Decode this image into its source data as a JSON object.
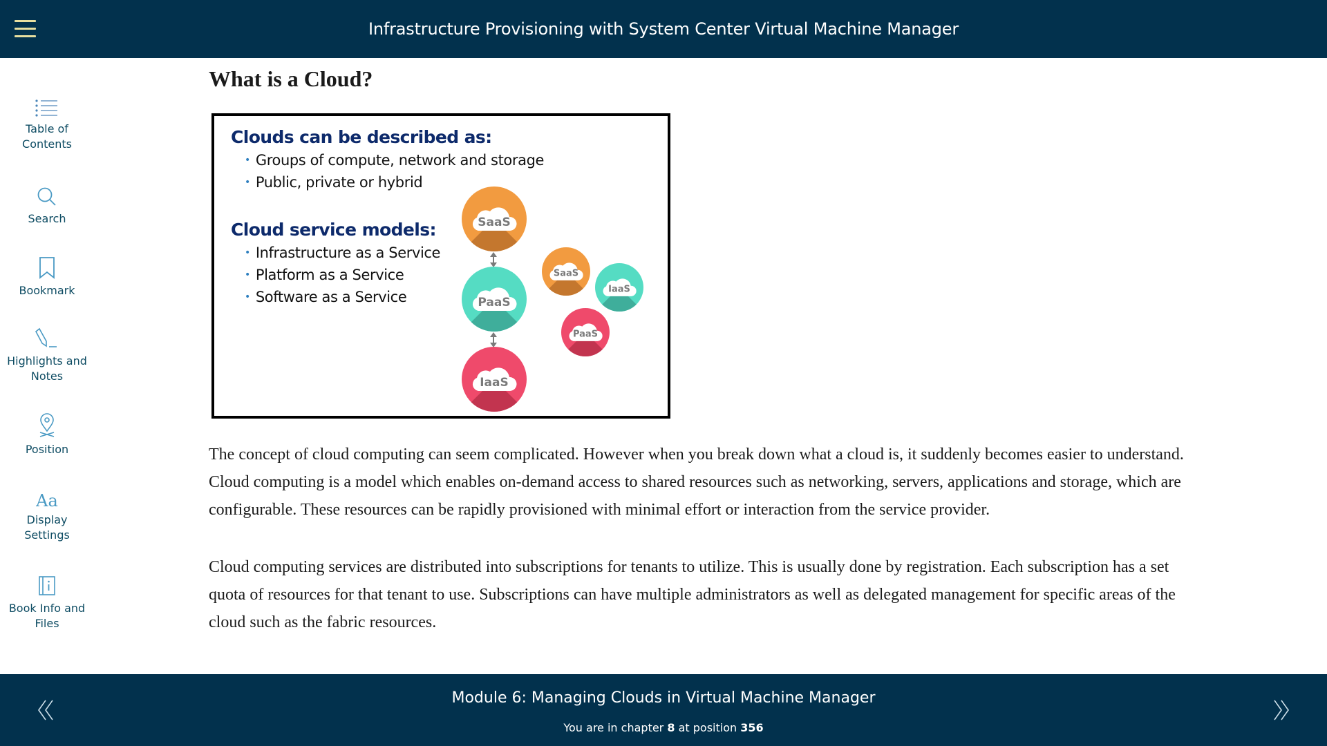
{
  "header": {
    "menu_icon": "hamburger-menu-icon",
    "title": "Infrastructure Provisioning with System Center Virtual Machine Manager"
  },
  "sidebar": {
    "items": [
      {
        "icon": "list-icon",
        "label": "Table of\nContents"
      },
      {
        "icon": "search-icon",
        "label": "Search"
      },
      {
        "icon": "bookmark-icon",
        "label": "Bookmark"
      },
      {
        "icon": "pencil-icon",
        "label": "Highlights and\nNotes"
      },
      {
        "icon": "location-pin-icon",
        "label": "Position"
      },
      {
        "icon": "font-aa-icon",
        "label": "Display\nSettings"
      },
      {
        "icon": "book-info-icon",
        "label": "Book Info and\nFiles"
      }
    ],
    "display_icon_text": "Aa"
  },
  "content": {
    "heading": "What is a Cloud?",
    "figure": {
      "heading1": "Clouds can be described as:",
      "list1": [
        "Groups of compute, network and storage",
        "Public, private or hybrid"
      ],
      "heading2": "Cloud service models:",
      "list2": [
        "Infrastructure as a Service",
        "Platform as a Service",
        "Software as a Service"
      ],
      "bullet": "•",
      "stack_clouds": [
        "SaaS",
        "PaaS",
        "IaaS"
      ],
      "cluster_clouds": [
        "SaaS",
        "IaaS",
        "PaaS"
      ],
      "colors": {
        "saas": "#f29b40",
        "saas_shadow": "#c4772e",
        "paas": "#55dcc3",
        "paas_shadow": "#3fae9b",
        "iaas": "#ef4a6b",
        "iaas_shadow": "#c2344f",
        "heading": "#0d2a6b",
        "bullet": "#2d7fbf"
      }
    },
    "paragraphs": [
      "The concept of cloud computing can seem complicated. However when you break down what a cloud is, it suddenly becomes easier to understand. Cloud computing is a model which enables on-demand access to shared resources such as networking, servers, applications and storage, which are configurable. These resources can be rapidly provisioned with minimal effort or interaction from the service provider.",
      "Cloud computing services are distributed into subscriptions for tenants to utilize. This is usually done by registration. Each subscription has a set quota of resources for that tenant to use. Subscriptions can have multiple administrators as well as delegated management for specific areas of the cloud such as the fabric resources."
    ]
  },
  "footer": {
    "prev_icon": "double-chevron-left-icon",
    "next_icon": "double-chevron-right-icon",
    "module_title": "Module 6: Managing Clouds in Virtual Machine Manager",
    "position_prefix": "You are in chapter",
    "chapter": "8",
    "position_mid": "at position",
    "position": "356"
  },
  "theme": {
    "bar_color": "#02314d",
    "sidebar_text": "#0e4c63",
    "sidebar_icon": "#4a9ac4",
    "menu_icon": "#e8dfa0"
  }
}
